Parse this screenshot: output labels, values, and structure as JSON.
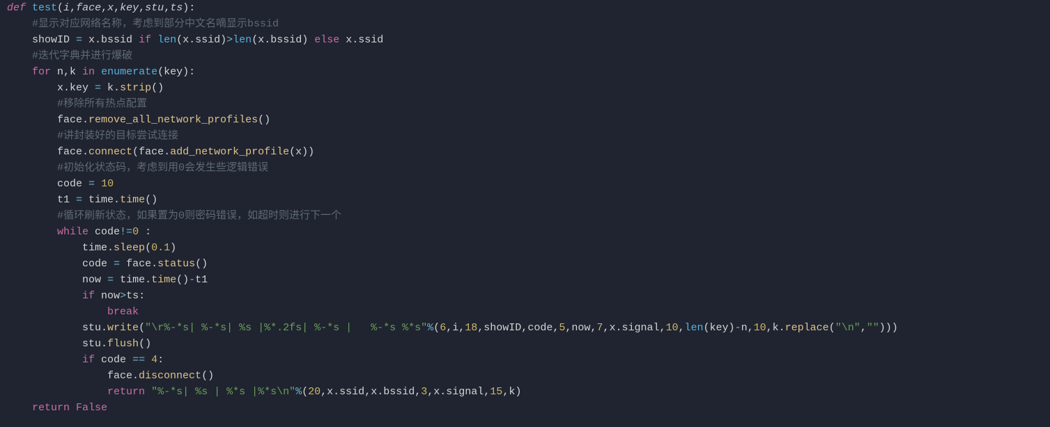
{
  "colors": {
    "bg": "#1f2430",
    "default": "#d4d4d4",
    "keyword": "#cc6da2",
    "storage": "#cc6da2",
    "def": "#cc6da2",
    "funcname": "#58b0e0",
    "param": "#c8d0d8",
    "paramItalic": "#c8d0d8",
    "comment": "#5f6a74",
    "ident": "#d4d4d4",
    "attr": "#d4d4d4",
    "op": "#6fb7d0",
    "punct": "#d4d4d4",
    "number": "#d0b867",
    "string": "#6a9f59",
    "builtin": "#58b0e0",
    "const": "#cc6da2",
    "call": "#e0c28c"
  },
  "code": [
    [
      {
        "t": "keyword",
        "s": "def ",
        "italic": true
      },
      {
        "t": "funcname",
        "s": "test"
      },
      {
        "t": "punct",
        "s": "("
      },
      {
        "t": "param",
        "s": "i",
        "italic": true
      },
      {
        "t": "punct",
        "s": ","
      },
      {
        "t": "param",
        "s": "face",
        "italic": true
      },
      {
        "t": "punct",
        "s": ","
      },
      {
        "t": "param",
        "s": "x",
        "italic": true
      },
      {
        "t": "punct",
        "s": ","
      },
      {
        "t": "param",
        "s": "key",
        "italic": true
      },
      {
        "t": "punct",
        "s": ","
      },
      {
        "t": "param",
        "s": "stu",
        "italic": true
      },
      {
        "t": "punct",
        "s": ","
      },
      {
        "t": "param",
        "s": "ts",
        "italic": true
      },
      {
        "t": "punct",
        "s": "):"
      }
    ],
    [
      {
        "t": "indent",
        "n": 4
      },
      {
        "t": "comment",
        "s": "#显示对应网络名称，考虑到部分中文名嘀显示bssid"
      }
    ],
    [
      {
        "t": "indent",
        "n": 4
      },
      {
        "t": "ident",
        "s": "showID "
      },
      {
        "t": "op",
        "s": "="
      },
      {
        "t": "ident",
        "s": " x.bssid "
      },
      {
        "t": "keyword",
        "s": "if"
      },
      {
        "t": "ident",
        "s": " "
      },
      {
        "t": "builtin",
        "s": "len"
      },
      {
        "t": "punct",
        "s": "("
      },
      {
        "t": "ident",
        "s": "x.ssid"
      },
      {
        "t": "punct",
        "s": ")"
      },
      {
        "t": "op",
        "s": ">"
      },
      {
        "t": "builtin",
        "s": "len"
      },
      {
        "t": "punct",
        "s": "("
      },
      {
        "t": "ident",
        "s": "x.bssid"
      },
      {
        "t": "punct",
        "s": ") "
      },
      {
        "t": "keyword",
        "s": "else"
      },
      {
        "t": "ident",
        "s": " x.ssid"
      }
    ],
    [
      {
        "t": "indent",
        "n": 4
      },
      {
        "t": "comment",
        "s": "#迭代字典并进行爆破"
      }
    ],
    [
      {
        "t": "indent",
        "n": 4
      },
      {
        "t": "keyword",
        "s": "for"
      },
      {
        "t": "ident",
        "s": " n,k "
      },
      {
        "t": "keyword",
        "s": "in"
      },
      {
        "t": "ident",
        "s": " "
      },
      {
        "t": "builtin",
        "s": "enumerate"
      },
      {
        "t": "punct",
        "s": "("
      },
      {
        "t": "ident",
        "s": "key"
      },
      {
        "t": "punct",
        "s": "):"
      }
    ],
    [
      {
        "t": "indent",
        "n": 8
      },
      {
        "t": "ident",
        "s": "x.key "
      },
      {
        "t": "op",
        "s": "="
      },
      {
        "t": "ident",
        "s": " k."
      },
      {
        "t": "call",
        "s": "strip"
      },
      {
        "t": "punct",
        "s": "()"
      }
    ],
    [
      {
        "t": "indent",
        "n": 8
      },
      {
        "t": "comment",
        "s": "#移除所有热点配置"
      }
    ],
    [
      {
        "t": "indent",
        "n": 8
      },
      {
        "t": "ident",
        "s": "face."
      },
      {
        "t": "call",
        "s": "remove_all_network_profiles"
      },
      {
        "t": "punct",
        "s": "()"
      }
    ],
    [
      {
        "t": "indent",
        "n": 8
      },
      {
        "t": "comment",
        "s": "#讲封装好的目标尝试连接"
      }
    ],
    [
      {
        "t": "indent",
        "n": 8
      },
      {
        "t": "ident",
        "s": "face."
      },
      {
        "t": "call",
        "s": "connect"
      },
      {
        "t": "punct",
        "s": "("
      },
      {
        "t": "ident",
        "s": "face."
      },
      {
        "t": "call",
        "s": "add_network_profile"
      },
      {
        "t": "punct",
        "s": "("
      },
      {
        "t": "ident",
        "s": "x"
      },
      {
        "t": "punct",
        "s": "))"
      }
    ],
    [
      {
        "t": "indent",
        "n": 8
      },
      {
        "t": "comment",
        "s": "#初始化状态码，考虑到用0会发生些逻辑错误"
      }
    ],
    [
      {
        "t": "indent",
        "n": 8
      },
      {
        "t": "ident",
        "s": "code "
      },
      {
        "t": "op",
        "s": "="
      },
      {
        "t": "ident",
        "s": " "
      },
      {
        "t": "number",
        "s": "10"
      }
    ],
    [
      {
        "t": "indent",
        "n": 8
      },
      {
        "t": "ident",
        "s": "t1 "
      },
      {
        "t": "op",
        "s": "="
      },
      {
        "t": "ident",
        "s": " time."
      },
      {
        "t": "call",
        "s": "time"
      },
      {
        "t": "punct",
        "s": "()"
      }
    ],
    [
      {
        "t": "indent",
        "n": 8
      },
      {
        "t": "comment",
        "s": "#循环刷新状态，如果置为0则密码错误，如超时则进行下一个"
      }
    ],
    [
      {
        "t": "indent",
        "n": 8
      },
      {
        "t": "keyword",
        "s": "while"
      },
      {
        "t": "ident",
        "s": " code"
      },
      {
        "t": "op",
        "s": "!="
      },
      {
        "t": "number",
        "s": "0"
      },
      {
        "t": "ident",
        "s": " :"
      }
    ],
    [
      {
        "t": "indent",
        "n": 12
      },
      {
        "t": "ident",
        "s": "time."
      },
      {
        "t": "call",
        "s": "sleep"
      },
      {
        "t": "punct",
        "s": "("
      },
      {
        "t": "number",
        "s": "0.1"
      },
      {
        "t": "punct",
        "s": ")"
      }
    ],
    [
      {
        "t": "indent",
        "n": 12
      },
      {
        "t": "ident",
        "s": "code "
      },
      {
        "t": "op",
        "s": "="
      },
      {
        "t": "ident",
        "s": " face."
      },
      {
        "t": "call",
        "s": "status"
      },
      {
        "t": "punct",
        "s": "()"
      }
    ],
    [
      {
        "t": "indent",
        "n": 12
      },
      {
        "t": "ident",
        "s": "now "
      },
      {
        "t": "op",
        "s": "="
      },
      {
        "t": "ident",
        "s": " time."
      },
      {
        "t": "call",
        "s": "time"
      },
      {
        "t": "punct",
        "s": "()"
      },
      {
        "t": "op",
        "s": "-"
      },
      {
        "t": "ident",
        "s": "t1"
      }
    ],
    [
      {
        "t": "indent",
        "n": 12
      },
      {
        "t": "keyword",
        "s": "if"
      },
      {
        "t": "ident",
        "s": " now"
      },
      {
        "t": "op",
        "s": ">"
      },
      {
        "t": "ident",
        "s": "ts:"
      }
    ],
    [
      {
        "t": "indent",
        "n": 16
      },
      {
        "t": "keyword",
        "s": "break"
      }
    ],
    [
      {
        "t": "indent",
        "n": 12
      },
      {
        "t": "ident",
        "s": "stu."
      },
      {
        "t": "call",
        "s": "write"
      },
      {
        "t": "punct",
        "s": "("
      },
      {
        "t": "string",
        "s": "\"\\r%-*s| %-*s| %s |%*.2fs| %-*s |   %-*s %*s\""
      },
      {
        "t": "op",
        "s": "%"
      },
      {
        "t": "punct",
        "s": "("
      },
      {
        "t": "number",
        "s": "6"
      },
      {
        "t": "punct",
        "s": ","
      },
      {
        "t": "ident",
        "s": "i"
      },
      {
        "t": "punct",
        "s": ","
      },
      {
        "t": "number",
        "s": "18"
      },
      {
        "t": "punct",
        "s": ","
      },
      {
        "t": "ident",
        "s": "showID"
      },
      {
        "t": "punct",
        "s": ","
      },
      {
        "t": "ident",
        "s": "code"
      },
      {
        "t": "punct",
        "s": ","
      },
      {
        "t": "number",
        "s": "5"
      },
      {
        "t": "punct",
        "s": ","
      },
      {
        "t": "ident",
        "s": "now"
      },
      {
        "t": "punct",
        "s": ","
      },
      {
        "t": "number",
        "s": "7"
      },
      {
        "t": "punct",
        "s": ","
      },
      {
        "t": "ident",
        "s": "x.signal"
      },
      {
        "t": "punct",
        "s": ","
      },
      {
        "t": "number",
        "s": "10"
      },
      {
        "t": "punct",
        "s": ","
      },
      {
        "t": "builtin",
        "s": "len"
      },
      {
        "t": "punct",
        "s": "("
      },
      {
        "t": "ident",
        "s": "key"
      },
      {
        "t": "punct",
        "s": ")"
      },
      {
        "t": "op",
        "s": "-"
      },
      {
        "t": "ident",
        "s": "n"
      },
      {
        "t": "punct",
        "s": ","
      },
      {
        "t": "number",
        "s": "10"
      },
      {
        "t": "punct",
        "s": ","
      },
      {
        "t": "ident",
        "s": "k."
      },
      {
        "t": "call",
        "s": "replace"
      },
      {
        "t": "punct",
        "s": "("
      },
      {
        "t": "string",
        "s": "\"\\n\""
      },
      {
        "t": "punct",
        "s": ","
      },
      {
        "t": "string",
        "s": "\"\""
      },
      {
        "t": "punct",
        "s": ")))"
      }
    ],
    [
      {
        "t": "indent",
        "n": 12
      },
      {
        "t": "ident",
        "s": "stu."
      },
      {
        "t": "call",
        "s": "flush"
      },
      {
        "t": "punct",
        "s": "()"
      }
    ],
    [
      {
        "t": "indent",
        "n": 12
      },
      {
        "t": "keyword",
        "s": "if"
      },
      {
        "t": "ident",
        "s": " code "
      },
      {
        "t": "op",
        "s": "=="
      },
      {
        "t": "ident",
        "s": " "
      },
      {
        "t": "number",
        "s": "4"
      },
      {
        "t": "punct",
        "s": ":"
      }
    ],
    [
      {
        "t": "indent",
        "n": 16
      },
      {
        "t": "ident",
        "s": "face."
      },
      {
        "t": "call",
        "s": "disconnect"
      },
      {
        "t": "punct",
        "s": "()"
      }
    ],
    [
      {
        "t": "indent",
        "n": 16
      },
      {
        "t": "keyword",
        "s": "return"
      },
      {
        "t": "ident",
        "s": " "
      },
      {
        "t": "string",
        "s": "\"%-*s| %s | %*s |%*s\\n\""
      },
      {
        "t": "op",
        "s": "%"
      },
      {
        "t": "punct",
        "s": "("
      },
      {
        "t": "number",
        "s": "20"
      },
      {
        "t": "punct",
        "s": ","
      },
      {
        "t": "ident",
        "s": "x.ssid"
      },
      {
        "t": "punct",
        "s": ","
      },
      {
        "t": "ident",
        "s": "x.bssid"
      },
      {
        "t": "punct",
        "s": ","
      },
      {
        "t": "number",
        "s": "3"
      },
      {
        "t": "punct",
        "s": ","
      },
      {
        "t": "ident",
        "s": "x.signal"
      },
      {
        "t": "punct",
        "s": ","
      },
      {
        "t": "number",
        "s": "15"
      },
      {
        "t": "punct",
        "s": ","
      },
      {
        "t": "ident",
        "s": "k"
      },
      {
        "t": "punct",
        "s": ")"
      }
    ],
    [
      {
        "t": "indent",
        "n": 4
      },
      {
        "t": "keyword",
        "s": "return"
      },
      {
        "t": "ident",
        "s": " "
      },
      {
        "t": "const",
        "s": "False"
      }
    ]
  ]
}
